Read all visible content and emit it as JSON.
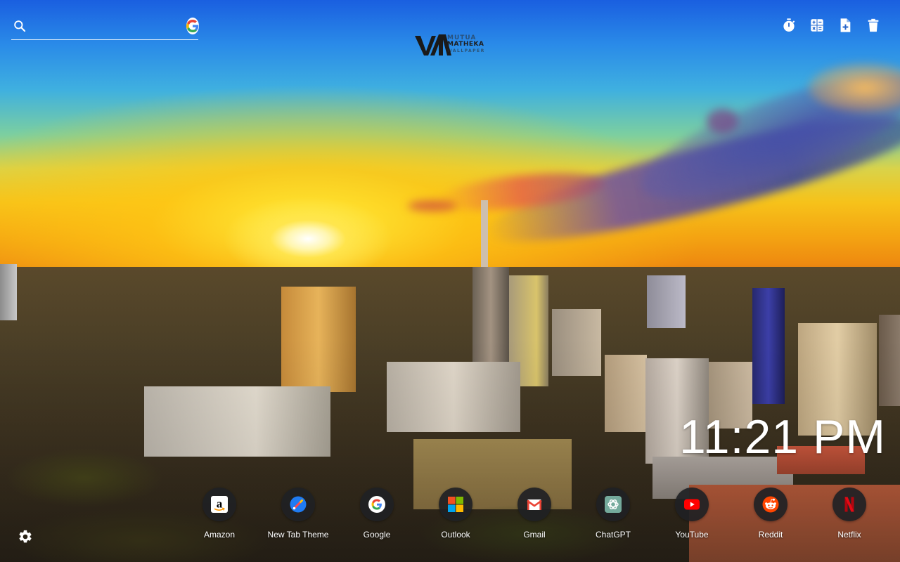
{
  "search": {
    "placeholder": "",
    "value": "",
    "icon": "search-icon",
    "engine": "google"
  },
  "logo": {
    "line1": "MUTUA",
    "line2": "MATHEKA",
    "line3": "WALLPAPER"
  },
  "toolbar": {
    "items": [
      {
        "name": "timer",
        "icon": "stopwatch-icon"
      },
      {
        "name": "calculator",
        "icon": "calculator-icon"
      },
      {
        "name": "add-note",
        "icon": "add-file-icon"
      },
      {
        "name": "delete",
        "icon": "trash-icon"
      }
    ]
  },
  "clock": {
    "time": "11:21 PM"
  },
  "shortcuts": [
    {
      "label": "Amazon",
      "icon": "amazon-icon"
    },
    {
      "label": "New Tab Theme",
      "icon": "new-tab-theme-icon"
    },
    {
      "label": "Google",
      "icon": "google-icon"
    },
    {
      "label": "Outlook",
      "icon": "outlook-icon"
    },
    {
      "label": "Gmail",
      "icon": "gmail-icon"
    },
    {
      "label": "ChatGPT",
      "icon": "chatgpt-icon"
    },
    {
      "label": "YouTube",
      "icon": "youtube-icon"
    },
    {
      "label": "Reddit",
      "icon": "reddit-icon"
    },
    {
      "label": "Netflix",
      "icon": "netflix-icon"
    }
  ],
  "settings": {
    "icon": "gear-icon"
  },
  "colors": {
    "icon": "#ffffff",
    "shortcut_bg": "#202124",
    "google_blue": "#4285F4",
    "google_red": "#EA4335",
    "google_yellow": "#FBBC05",
    "google_green": "#34A853",
    "youtube_red": "#FF0000",
    "reddit_orange": "#FF4500",
    "netflix_red": "#E50914",
    "chatgpt_green": "#74AA9C"
  }
}
